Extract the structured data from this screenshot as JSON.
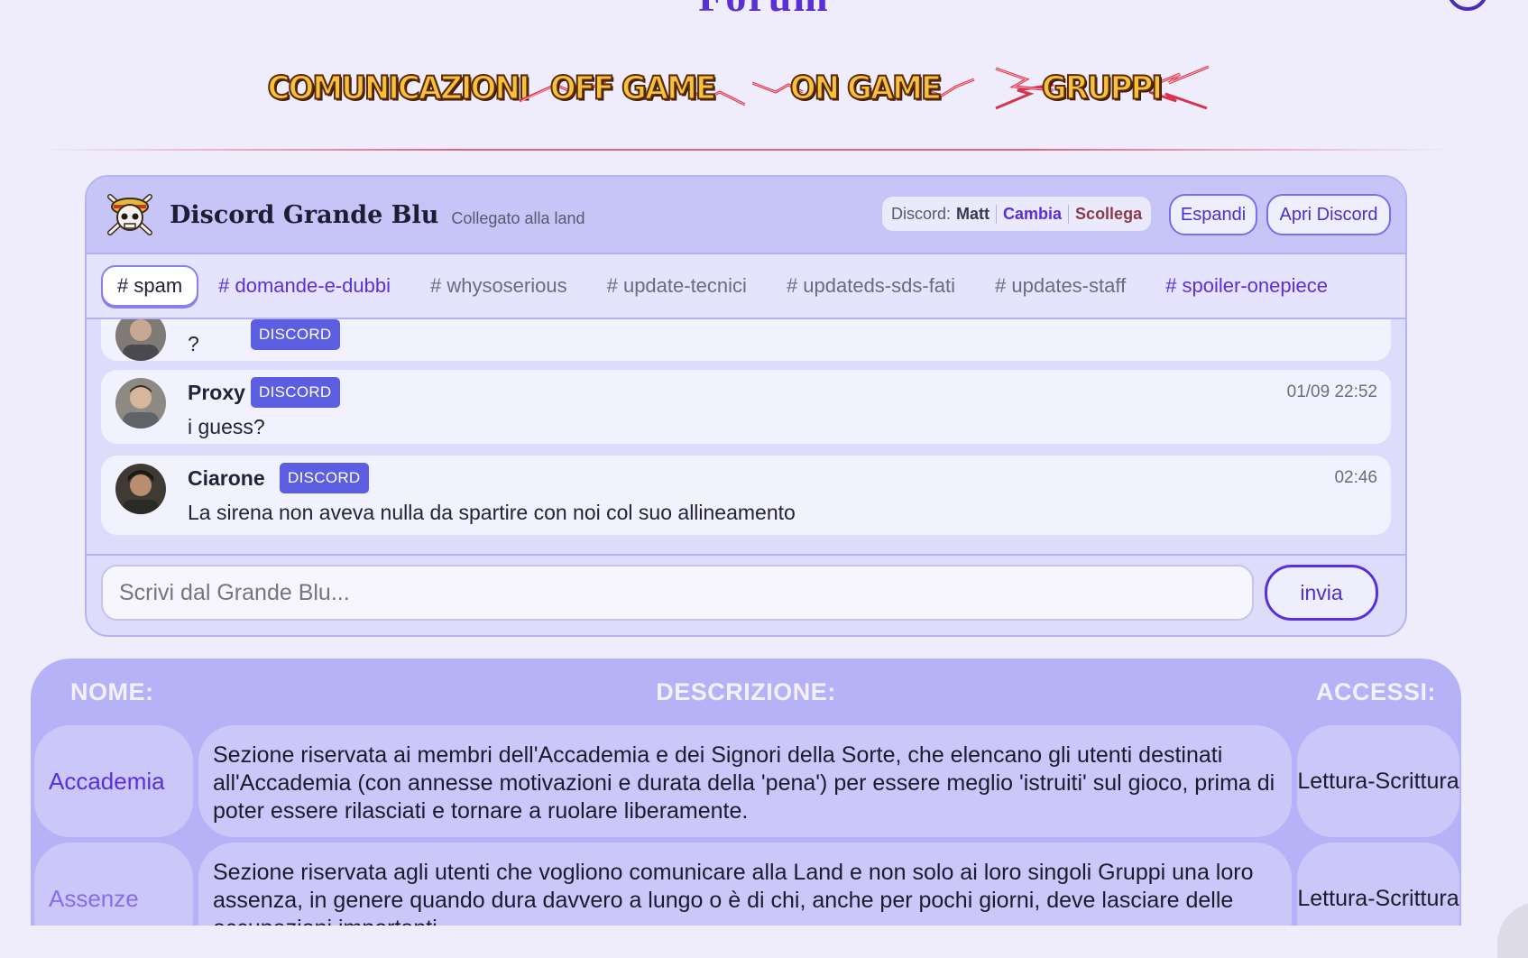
{
  "page": {
    "heading": "Forum"
  },
  "nav": {
    "banners": [
      {
        "label": "COMUNICAZIONI"
      },
      {
        "label": "OFF GAME"
      },
      {
        "label": "ON GAME"
      },
      {
        "label": "GRUPPI"
      }
    ]
  },
  "discord": {
    "title": "Discord Grande Blu",
    "status": "Collegato alla land",
    "account": {
      "label": "Discord:",
      "user": "Matt",
      "change": "Cambia",
      "unlink": "Scollega"
    },
    "expand_label": "Espandi",
    "open_label": "Apri Discord",
    "tabs": [
      {
        "label": "# spam"
      },
      {
        "label": "# domande-e-dubbi"
      },
      {
        "label": "# whysoserious"
      },
      {
        "label": "# update-tecnici"
      },
      {
        "label": "# updateds-sds-fati"
      },
      {
        "label": "# updates-staff"
      },
      {
        "label": "# spoiler-onepiece"
      }
    ],
    "messages": [
      {
        "author": "",
        "badge": "DISCORD",
        "time": "",
        "text": "?"
      },
      {
        "author": "Proxy",
        "badge": "DISCORD",
        "time": "01/09 22:52",
        "text": "i guess?"
      },
      {
        "author": "Ciarone",
        "badge": "DISCORD",
        "time": "02:46",
        "text": "La sirena non aveva nulla da spartire con noi col suo allineamento"
      }
    ],
    "compose": {
      "placeholder": "Scrivi dal Grande Blu...",
      "send_label": "invia"
    }
  },
  "forum": {
    "headers": {
      "name": "NOME:",
      "description": "DESCRIZIONE:",
      "access": "ACCESSI:"
    },
    "rows": [
      {
        "name": "Accademia",
        "description": "Sezione riservata ai membri dell'Accademia e dei Signori della Sorte, che elencano gli utenti destinati all'Accademia (con annesse motivazioni e durata della 'pena') per essere meglio 'istruiti' sul gioco, prima di poter essere rilasciati e tornare a ruolare liberamente.",
        "access": "Lettura-Scrittura"
      },
      {
        "name": "Assenze",
        "description": "Sezione riservata agli utenti che vogliono comunicare alla Land e non solo ai loro singoli Gruppi una loro assenza, in genere quando dura davvero a lungo o è di chi, anche per pochi giorni, deve lasciare delle occupazioni importanti.",
        "access": "Lettura-Scrittura"
      }
    ]
  }
}
